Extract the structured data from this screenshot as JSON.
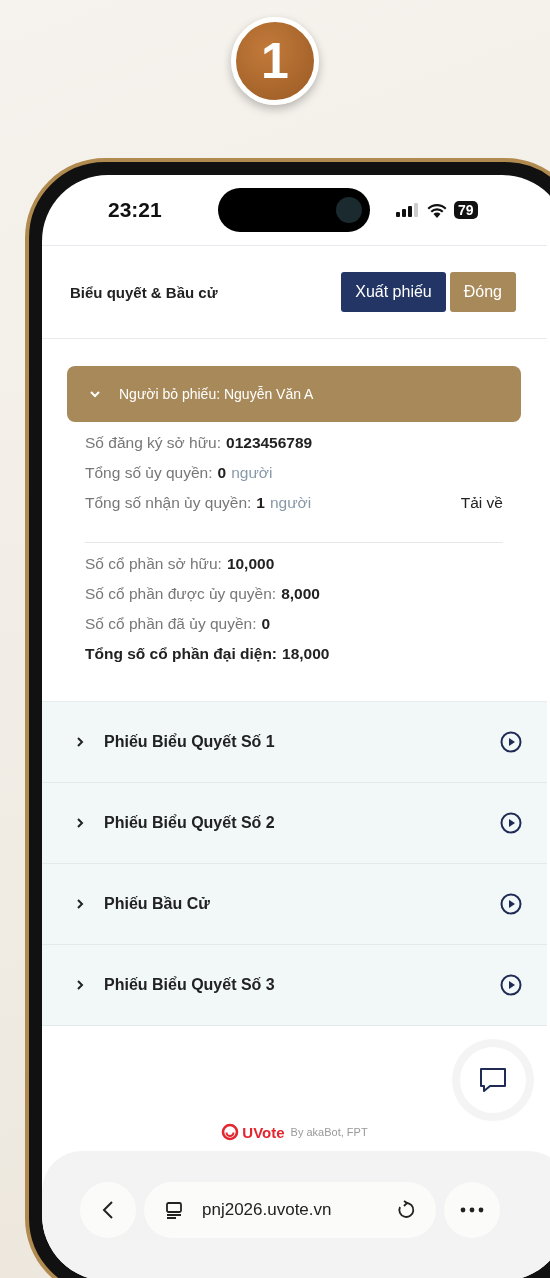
{
  "badge": "1",
  "status_bar": {
    "time": "23:21",
    "battery": "79"
  },
  "header": {
    "title": "Biểu quyết & Bầu cử",
    "buttons": [
      {
        "label": "Xuất phiếu",
        "kind": "primary"
      },
      {
        "label": "Đóng",
        "kind": "secondary"
      }
    ]
  },
  "voter": {
    "label": "Người bỏ phiếu: Nguyễn Văn A",
    "expanded": true,
    "details": [
      {
        "label": "Số đăng ký sở hữu:",
        "value": "0123456789"
      },
      {
        "label": "Tổng số ủy quyền:",
        "value": "0",
        "unit": "người"
      },
      {
        "label": "Tổng số nhận ủy quyền:",
        "value": "1",
        "unit": "người",
        "action": "Tải về"
      }
    ],
    "shares": [
      {
        "label": "Số cổ phần sở hữu:",
        "value": "10,000",
        "emphasis": false
      },
      {
        "label": "Số cổ phần được ủy quyền:",
        "value": "8,000",
        "emphasis": false
      },
      {
        "label": "Số cổ phần đã ủy quyền:",
        "value": "0",
        "emphasis": false
      },
      {
        "label": "Tổng số cổ phần đại diện:",
        "value": "18,000",
        "emphasis": true
      }
    ]
  },
  "ballots": [
    {
      "title": "Phiếu Biểu Quyết Số 1",
      "expanded": false
    },
    {
      "title": "Phiếu Biểu Quyết Số 2",
      "expanded": false
    },
    {
      "title": "Phiếu Bầu Cử",
      "expanded": false
    },
    {
      "title": "Phiếu Biểu Quyết Số 3",
      "expanded": false
    }
  ],
  "footer": {
    "brand": "UVote",
    "credit": "By akaBot, FPT"
  },
  "browser": {
    "url": "pnj2026.uvote.vn"
  }
}
